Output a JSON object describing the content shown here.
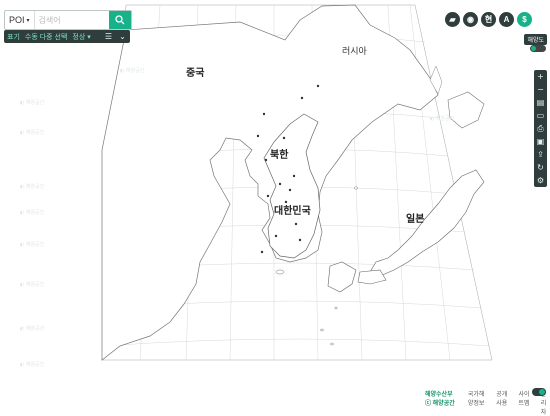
{
  "search": {
    "poi_label": "POI",
    "placeholder": "검색어"
  },
  "filter": {
    "item1": "표기",
    "item2": "수동 다중 선택",
    "item3": "정상 ▾"
  },
  "top_icons": {
    "b3": "현",
    "b4": "A",
    "b5": "$"
  },
  "layer_label": "해양도",
  "bottom": {
    "brand": "해양수산부 ⓒ 해양공간",
    "link1": "국가해양정보",
    "link2": "공개사용",
    "link3": "사이트맵",
    "link4": "관리자"
  },
  "countries": [
    {
      "name": "러시아"
    },
    {
      "name": "중국"
    },
    {
      "name": "북한"
    },
    {
      "name": "대한민국"
    },
    {
      "name": "일본"
    }
  ],
  "colors": {
    "accent": "#17b28a",
    "dark": "#2f3d3c"
  },
  "icons": {
    "search": "search-icon",
    "side": [
      "plus-icon",
      "minus-icon",
      "layers-icon",
      "ruler-icon",
      "print-icon",
      "save-icon",
      "share-icon",
      "refresh-icon",
      "settings-icon"
    ]
  }
}
